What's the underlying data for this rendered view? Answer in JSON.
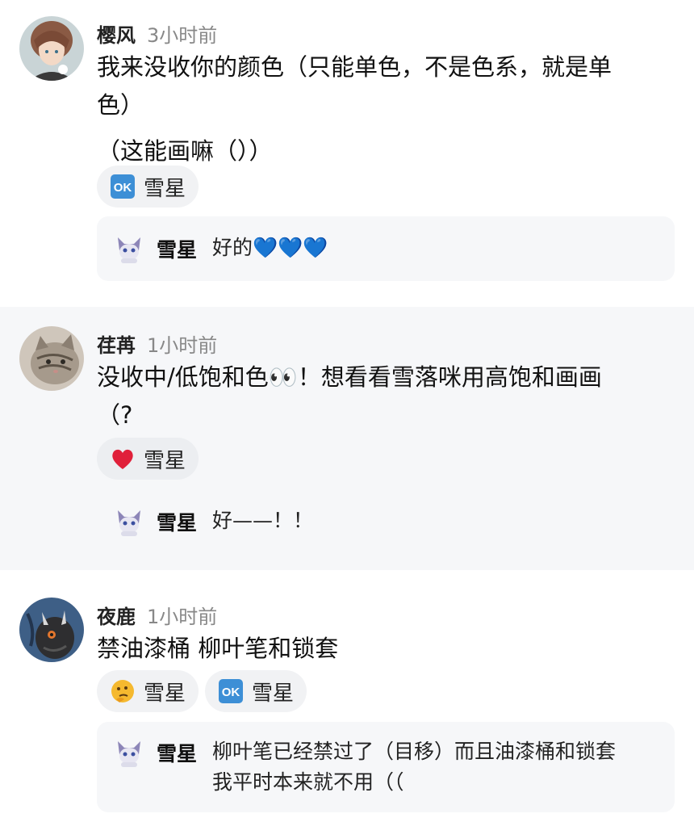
{
  "comments": [
    {
      "username": "樱风",
      "time": "3小时前",
      "text_line1": "我来没收你的颜色（只能单色，不是色系，就是单",
      "text_line2": "色）",
      "text_line3": "（这能画嘛（））",
      "reactions": [
        {
          "icon": "ok-emoji-icon",
          "label": "雪星"
        }
      ],
      "reply": {
        "username": "雪星",
        "text": "好的💙💙💙"
      }
    },
    {
      "username": "荏苒",
      "time": "1小时前",
      "text_line1": "没收中/低饱和色👀！想看看雪落咪用高饱和画画",
      "text_line2": "（?",
      "reactions": [
        {
          "icon": "red-heart-icon",
          "label": "雪星"
        }
      ],
      "reply": {
        "username": "雪星",
        "text": "好——！！"
      }
    },
    {
      "username": "夜鹿",
      "time": "1小时前",
      "text_line1": "禁油漆桶 柳叶笔和锁套",
      "reactions": [
        {
          "icon": "thinking-face-icon",
          "label": "雪星"
        },
        {
          "icon": "ok-emoji-icon",
          "label": "雪星"
        }
      ],
      "reply": {
        "username": "雪星",
        "text_line1": "柳叶笔已经禁过了（目移）而且油漆桶和锁套",
        "text_line2": "我平时本来就不用（（"
      }
    }
  ],
  "colors": {
    "alt_background": "#f6f7f9",
    "reaction_background": "#f1f2f4",
    "time_gray": "#888888"
  }
}
